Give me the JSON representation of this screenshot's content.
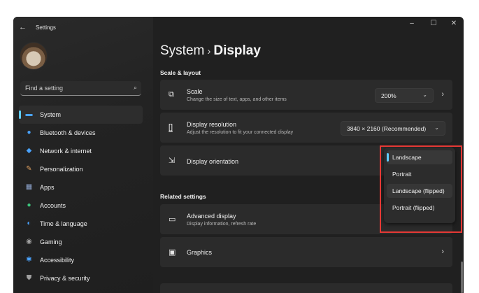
{
  "app": {
    "title": "Settings",
    "back_icon": "arrow-left-icon"
  },
  "window_controls": {
    "minimize": "–",
    "maximize": "☐",
    "close": "✕"
  },
  "search": {
    "placeholder": "Find a setting",
    "icon": "search-icon"
  },
  "sidebar": {
    "items": [
      {
        "label": "System",
        "icon": "monitor-icon",
        "color": "#4aa3ff",
        "active": true
      },
      {
        "label": "Bluetooth & devices",
        "icon": "bluetooth-icon",
        "color": "#4aa3ff"
      },
      {
        "label": "Network & internet",
        "icon": "wifi-icon",
        "color": "#4aa3ff"
      },
      {
        "label": "Personalization",
        "icon": "brush-icon",
        "color": "#e0a060"
      },
      {
        "label": "Apps",
        "icon": "apps-icon",
        "color": "#8aa0c8"
      },
      {
        "label": "Accounts",
        "icon": "account-icon",
        "color": "#3cc47c"
      },
      {
        "label": "Time & language",
        "icon": "globe-clock-icon",
        "color": "#4aa3ff"
      },
      {
        "label": "Gaming",
        "icon": "gamepad-icon",
        "color": "#a0a0a0"
      },
      {
        "label": "Accessibility",
        "icon": "accessibility-icon",
        "color": "#4aa3ff"
      },
      {
        "label": "Privacy & security",
        "icon": "shield-icon",
        "color": "#a0a0a0"
      }
    ]
  },
  "breadcrumb": {
    "parent": "System",
    "separator": "›",
    "current": "Display"
  },
  "sections": {
    "scale_layout": "Scale & layout",
    "related": "Related settings"
  },
  "settings": {
    "scale": {
      "title": "Scale",
      "subtitle": "Change the size of text, apps, and other items",
      "value": "200%",
      "icon": "scale-icon"
    },
    "resolution": {
      "title": "Display resolution",
      "subtitle": "Adjust the resolution to fit your connected display",
      "value": "3840 × 2160 (Recommended)",
      "icon": "resolution-icon"
    },
    "orientation": {
      "title": "Display orientation",
      "icon": "orientation-icon"
    }
  },
  "orientation_options": [
    "Landscape",
    "Portrait",
    "Landscape (flipped)",
    "Portrait (flipped)"
  ],
  "related": {
    "advanced": {
      "title": "Advanced display",
      "subtitle": "Display information, refresh rate",
      "icon": "monitor-icon"
    },
    "graphics": {
      "title": "Graphics",
      "icon": "graphics-icon"
    }
  },
  "colors": {
    "accent": "#60cdff",
    "annotation": "#e53935",
    "background": "#202020",
    "card": "#2b2b2b"
  }
}
